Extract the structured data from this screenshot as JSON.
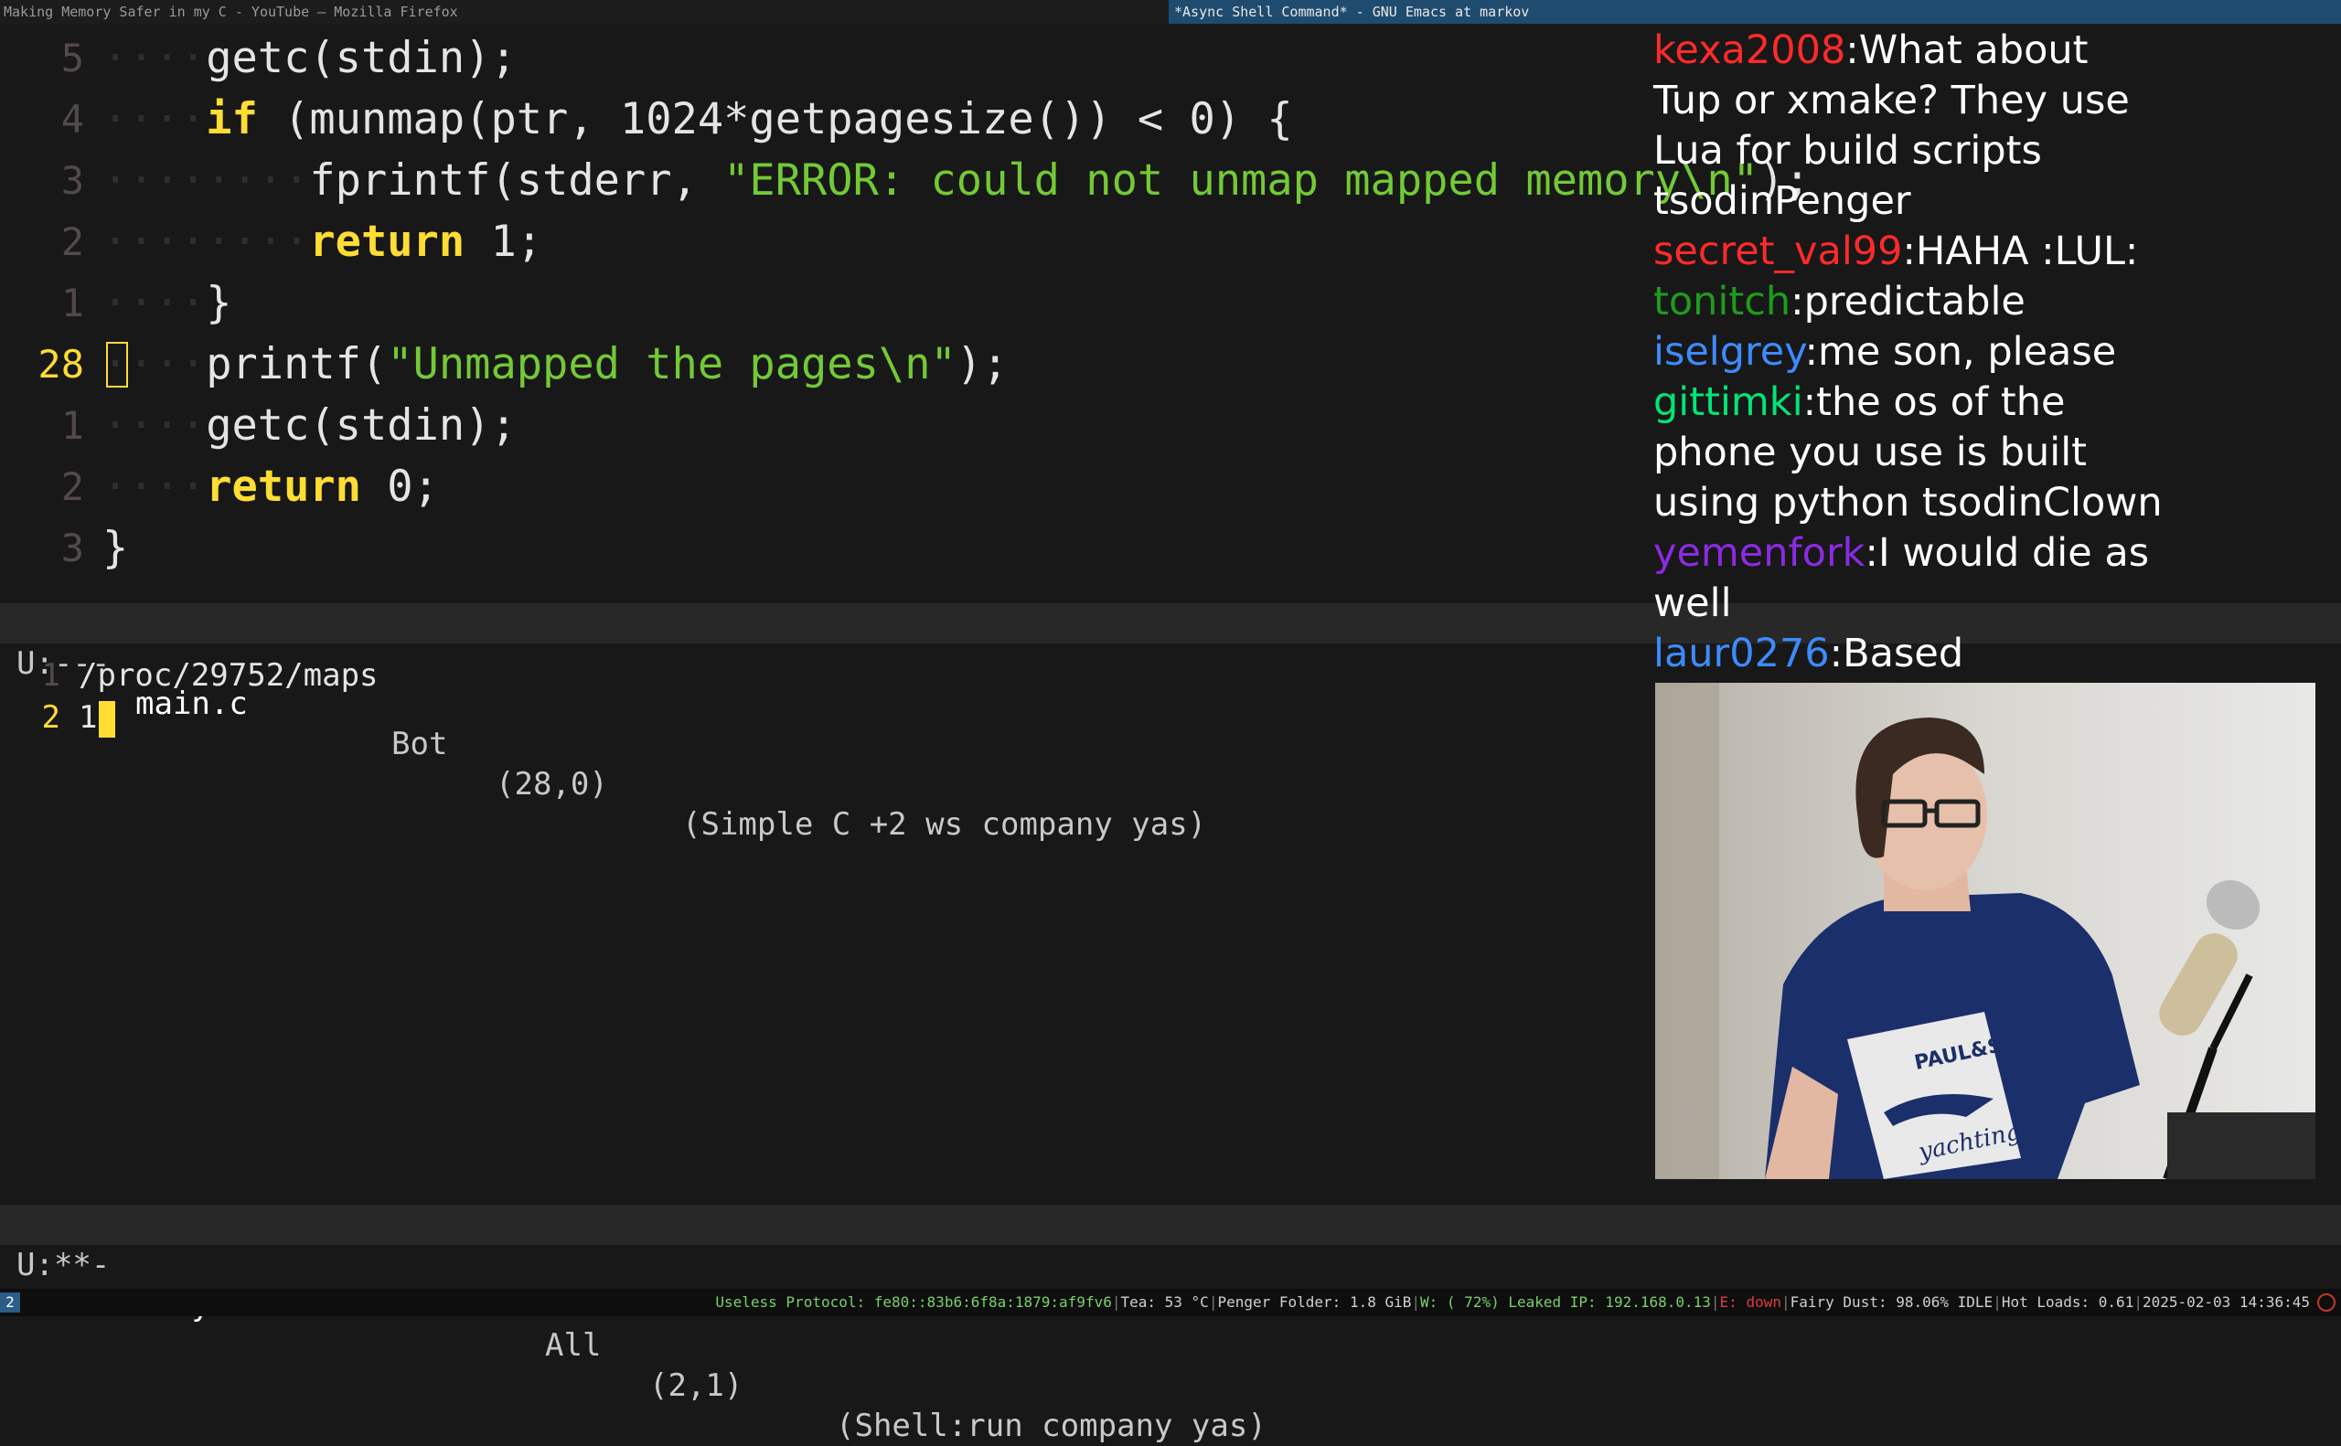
{
  "window_titles": {
    "left": "Making Memory Safer in my C - YouTube — Mozilla Firefox",
    "right": "*Async Shell Command* - GNU Emacs at markov"
  },
  "editor": {
    "lines": [
      {
        "num": "5",
        "indent": "····",
        "tokens": [
          {
            "t": "getc(stdin);",
            "c": "plain"
          }
        ]
      },
      {
        "num": "4",
        "indent": "····",
        "tokens": [
          {
            "t": "if",
            "c": "kw"
          },
          {
            "t": " (munmap(ptr, 1024*getpagesize()) < 0) {",
            "c": "plain"
          }
        ]
      },
      {
        "num": "3",
        "indent": "········",
        "tokens": [
          {
            "t": "fprintf(stderr, ",
            "c": "plain"
          },
          {
            "t": "\"ERROR: could not unmap mapped memory\\n\"",
            "c": "str"
          },
          {
            "t": ");",
            "c": "plain"
          }
        ]
      },
      {
        "num": "2",
        "indent": "········",
        "tokens": [
          {
            "t": "return",
            "c": "kw"
          },
          {
            "t": " 1;",
            "c": "plain"
          }
        ]
      },
      {
        "num": "1",
        "indent": "····",
        "tokens": [
          {
            "t": "}",
            "c": "plain"
          }
        ]
      },
      {
        "num": "28",
        "indent": "····",
        "current": true,
        "tokens": [
          {
            "t": "printf(",
            "c": "plain"
          },
          {
            "t": "\"Unmapped the pages\\n\"",
            "c": "str"
          },
          {
            "t": ");",
            "c": "plain"
          }
        ]
      },
      {
        "num": "1",
        "indent": "····",
        "tokens": [
          {
            "t": "getc(stdin);",
            "c": "plain"
          }
        ]
      },
      {
        "num": "2",
        "indent": "····",
        "tokens": [
          {
            "t": "return",
            "c": "kw"
          },
          {
            "t": " 0;",
            "c": "plain"
          }
        ]
      },
      {
        "num": "3",
        "indent": "",
        "tokens": [
          {
            "t": "}",
            "c": "plain"
          }
        ]
      }
    ]
  },
  "modeline_top": {
    "state": "U:---",
    "buffer": "main.c",
    "position": "Bot",
    "cursor": "(28,0)",
    "modes": "(Simple C +2 ws company yas)"
  },
  "shell": {
    "lines": [
      {
        "num": "1",
        "text": "/proc/29752/maps"
      },
      {
        "num": "2",
        "text": "1",
        "current": true
      }
    ]
  },
  "modeline_bottom": {
    "state": "U:**-",
    "buffer": "*Async Shell Command*",
    "position": "All",
    "cursor": "(2,1)",
    "modes": "(Shell:run company yas)"
  },
  "chat": [
    {
      "user": "kexa2008",
      "color": "#ff2a2a",
      "text": ":What about Tup or xmake? They use Lua for build scripts tsodinPenger"
    },
    {
      "user": "secret_val99",
      "color": "#ff2a2a",
      "text": ":HAHA :LUL:"
    },
    {
      "user": "tonitch",
      "color": "#1e9c1e",
      "text": ":predictable"
    },
    {
      "user": "iselgrey",
      "color": "#3d8bff",
      "text": ":me son, please"
    },
    {
      "user": "gittimki",
      "color": "#00e676",
      "text": ":the os of the phone you use is built using python tsodinClown"
    },
    {
      "user": "yemenfork",
      "color": "#8a2be2",
      "text": ":I would die as well"
    },
    {
      "user": "laur0276",
      "color": "#3d8bff",
      "text": ":Based"
    }
  ],
  "webcam": {
    "shirt_text_1": "PAUL&SHARK",
    "shirt_text_2": "yachting"
  },
  "statusbar": {
    "workspace": "2",
    "items": [
      {
        "text": "Useless Protocol: fe80::83b6:6f8a:1879:af9fv6",
        "color": "#7ad06b"
      },
      {
        "text": "|",
        "color": "#777777"
      },
      {
        "text": "Tea: 53 °C",
        "color": "#d0d0d0"
      },
      {
        "text": "|",
        "color": "#777777"
      },
      {
        "text": "Penger Folder: 1.8 GiB",
        "color": "#d0d0d0"
      },
      {
        "text": "|",
        "color": "#777777"
      },
      {
        "text": "W: ( 72%) Leaked IP: 192.168.0.13",
        "color": "#7ad06b"
      },
      {
        "text": "|",
        "color": "#777777"
      },
      {
        "text": "E: down",
        "color": "#e03b3b"
      },
      {
        "text": "|",
        "color": "#777777"
      },
      {
        "text": "Fairy Dust: 98.06% IDLE",
        "color": "#d0d0d0"
      },
      {
        "text": "|",
        "color": "#777777"
      },
      {
        "text": "Hot Loads: 0.61",
        "color": "#d0d0d0"
      },
      {
        "text": "|",
        "color": "#777777"
      },
      {
        "text": "2025-02-03 14:36:45",
        "color": "#d0d0d0"
      }
    ]
  }
}
